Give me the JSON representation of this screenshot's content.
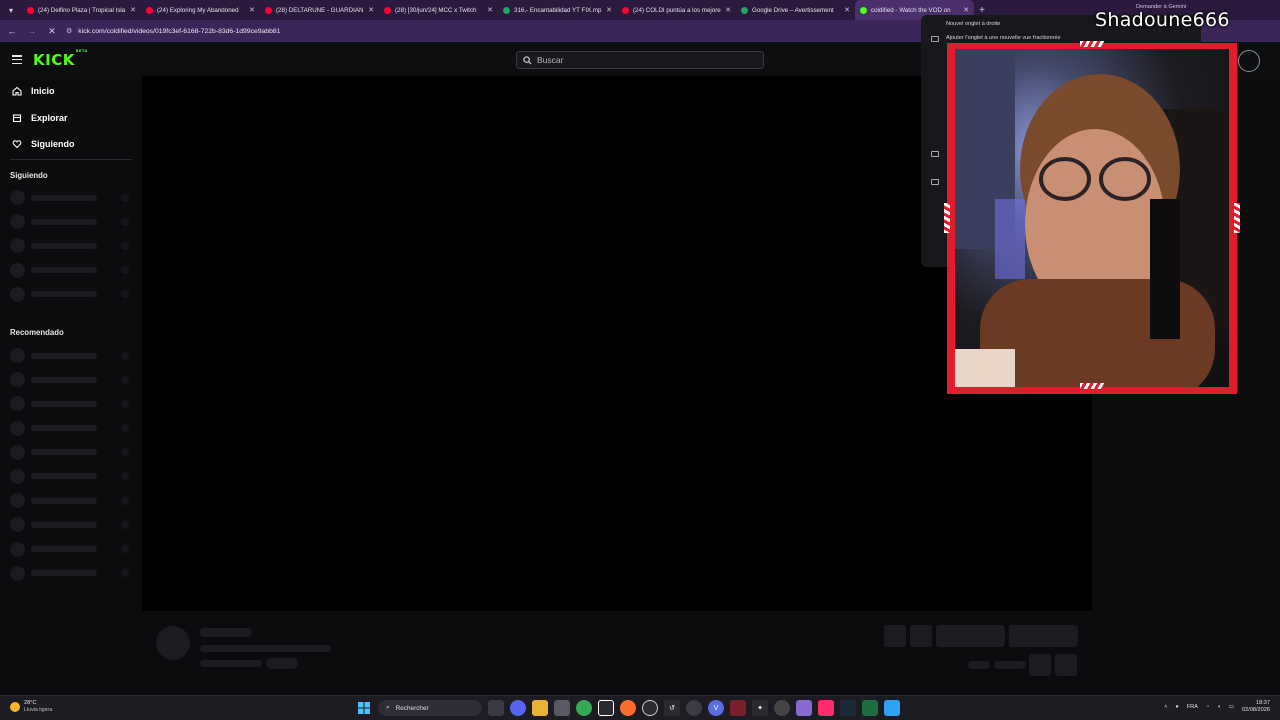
{
  "browser": {
    "tabs": [
      {
        "title": "(24) Delfino Plaza | Tropical Isla",
        "fav_color": "#ff0033"
      },
      {
        "title": "(24) Exploring My Abandoned",
        "fav_color": "#ff0033"
      },
      {
        "title": "(28) DELTARUNE - GUARDIAN",
        "fav_color": "#ff0033"
      },
      {
        "title": "(28) [30/jun/24] MCC x Twitch",
        "fav_color": "#ff0033"
      },
      {
        "title": "316,- Encantabilidad YT FIX.mp",
        "fav_color": "#1fa463"
      },
      {
        "title": "(24) COLDI puntúa a los mejore",
        "fav_color": "#ff0033"
      },
      {
        "title": "Google Drive – Avertissement",
        "fav_color": "#1fa463"
      },
      {
        "title": "coldified - Watch the VOD on",
        "fav_color": "#53fc18",
        "active": true
      }
    ],
    "new_tab": "+",
    "gemini": "Demander à Gemini",
    "url": "kick.com/coldified/videos/019fc3ef-6168-722b-83d6-1d99ce9abb81"
  },
  "popup": {
    "items": [
      "Nouvel onglet à droite",
      "Ajouter l'onglet à une nouvelle vue fractionnée"
    ]
  },
  "kick": {
    "logo": "KICK",
    "logo_badge": "BETA",
    "search_placeholder": "Buscar",
    "nav": [
      {
        "label": "Inicio",
        "icon": "home-icon"
      },
      {
        "label": "Explorar",
        "icon": "compass-icon"
      },
      {
        "label": "Siguiendo",
        "icon": "heart-icon"
      }
    ],
    "following_title": "Siguiendo",
    "recommended_title": "Recomendado"
  },
  "overlay": {
    "streamer_name": "Shadoune666"
  },
  "taskbar": {
    "weather_temp": "28°C",
    "weather_desc": "Lluvia ligera",
    "search_label": "Rechercher",
    "lang": "FRA",
    "time": "18:37",
    "date": "02/08/2026"
  },
  "colors": {
    "kick_green": "#53fc18",
    "overlay_red": "#e21c2c",
    "tabbar": "#2b1a3e"
  }
}
